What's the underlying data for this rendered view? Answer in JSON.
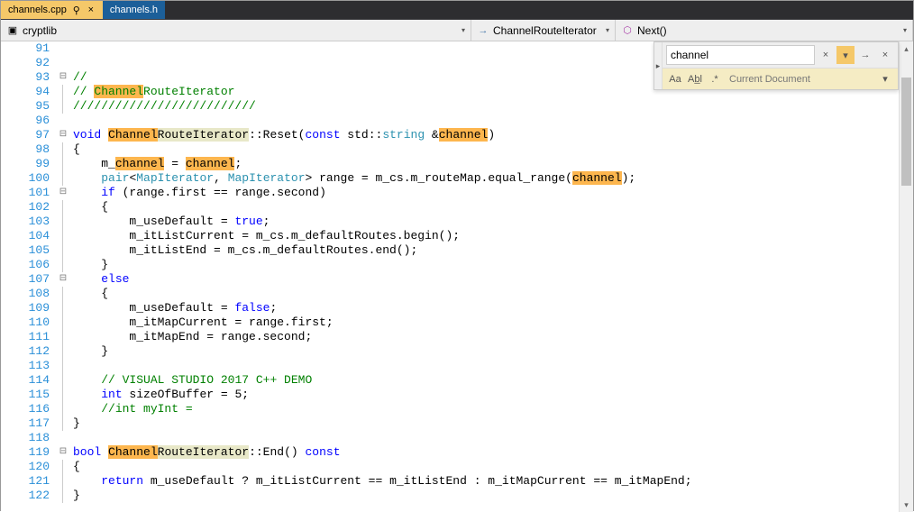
{
  "tabs": [
    {
      "label": "channels.cpp",
      "active": true,
      "pinned": true
    },
    {
      "label": "channels.h",
      "active": false,
      "pinned": false
    }
  ],
  "navbar": {
    "scope": "cryptlib",
    "class": "ChannelRouteIterator",
    "member": "Next()"
  },
  "find": {
    "expand_glyph": "▸",
    "query": "channel",
    "clear_glyph": "×",
    "dd_glyph": "▾",
    "next_glyph": "→",
    "close_glyph": "×",
    "case_label": "Aa",
    "word_label": "Ab̲l",
    "regex_label": ".*",
    "scope_label": "Current Document",
    "scope_dd": "▾"
  },
  "scroll": {
    "up": "▴",
    "down": "▾"
  },
  "chevron_down": "▾",
  "first_line_no": 91,
  "code": {
    "lines": [
      {
        "n": 91,
        "fold": "",
        "html": ""
      },
      {
        "n": 92,
        "fold": "",
        "html": ""
      },
      {
        "n": 93,
        "fold": "-",
        "html": "<span class='c-comment'>//</span>"
      },
      {
        "n": 94,
        "fold": "|",
        "html": "<span class='c-comment'>// <span class='hl'>Channel</span>RouteIterator</span>"
      },
      {
        "n": 95,
        "fold": "|",
        "html": "<span class='c-comment'>//////////////////////////</span>"
      },
      {
        "n": 96,
        "fold": "",
        "html": ""
      },
      {
        "n": 97,
        "fold": "-",
        "html": "<span class='c-keyword'>void</span> <span class='hl'>Channel</span><span class='hl-light'>RouteIterator</span>::Reset(<span class='c-keyword'>const</span> std::<span class='c-type'>string</span> &amp;<span class='hl'>channel</span>)"
      },
      {
        "n": 98,
        "fold": "|",
        "html": "{"
      },
      {
        "n": 99,
        "fold": "|",
        "html": "    m_<span class='hl'>channel</span> = <span class='hl'>channel</span>;"
      },
      {
        "n": 100,
        "fold": "|",
        "html": "    <span class='c-type'>pair</span>&lt;<span class='c-type'>MapIterator</span>, <span class='c-type'>MapIterator</span>&gt; range = m_cs.m_routeMap.equal_range(<span class='hl'>channel</span>);"
      },
      {
        "n": 101,
        "fold": "-",
        "html": "    <span class='c-keyword'>if</span> (range.first == range.second)"
      },
      {
        "n": 102,
        "fold": "|",
        "html": "    {"
      },
      {
        "n": 103,
        "fold": "|",
        "html": "        m_useDefault = <span class='c-keyword'>true</span>;"
      },
      {
        "n": 104,
        "fold": "|",
        "html": "        m_itListCurrent = m_cs.m_defaultRoutes.begin();"
      },
      {
        "n": 105,
        "fold": "|",
        "html": "        m_itListEnd = m_cs.m_defaultRoutes.end();"
      },
      {
        "n": 106,
        "fold": "|",
        "html": "    }"
      },
      {
        "n": 107,
        "fold": "-",
        "html": "    <span class='c-keyword'>else</span>"
      },
      {
        "n": 108,
        "fold": "|",
        "html": "    {"
      },
      {
        "n": 109,
        "fold": "|",
        "html": "        m_useDefault = <span class='c-keyword'>false</span>;"
      },
      {
        "n": 110,
        "fold": "|",
        "html": "        m_itMapCurrent = range.first;"
      },
      {
        "n": 111,
        "fold": "|",
        "html": "        m_itMapEnd = range.second;"
      },
      {
        "n": 112,
        "fold": "|",
        "html": "    }"
      },
      {
        "n": 113,
        "fold": "|",
        "html": ""
      },
      {
        "n": 114,
        "fold": "|",
        "html": "    <span class='c-comment'>// VISUAL STUDIO 2017 C++ DEMO</span>"
      },
      {
        "n": 115,
        "fold": "|",
        "html": "    <span class='c-keyword'>int</span> sizeOfBuffer = 5;"
      },
      {
        "n": 116,
        "fold": "|",
        "html": "    <span class='c-comment'>//int myInt = </span>"
      },
      {
        "n": 117,
        "fold": "|",
        "html": "}"
      },
      {
        "n": 118,
        "fold": "",
        "html": ""
      },
      {
        "n": 119,
        "fold": "-",
        "html": "<span class='c-keyword'>bool</span> <span class='hl'>Channel</span><span class='hl-light'>RouteIterator</span>::End() <span class='c-keyword'>const</span>"
      },
      {
        "n": 120,
        "fold": "|",
        "html": "{"
      },
      {
        "n": 121,
        "fold": "|",
        "html": "    <span class='c-keyword'>return</span> m_useDefault ? m_itListCurrent == m_itListEnd : m_itMapCurrent == m_itMapEnd;"
      },
      {
        "n": 122,
        "fold": "|",
        "html": "}"
      }
    ]
  }
}
